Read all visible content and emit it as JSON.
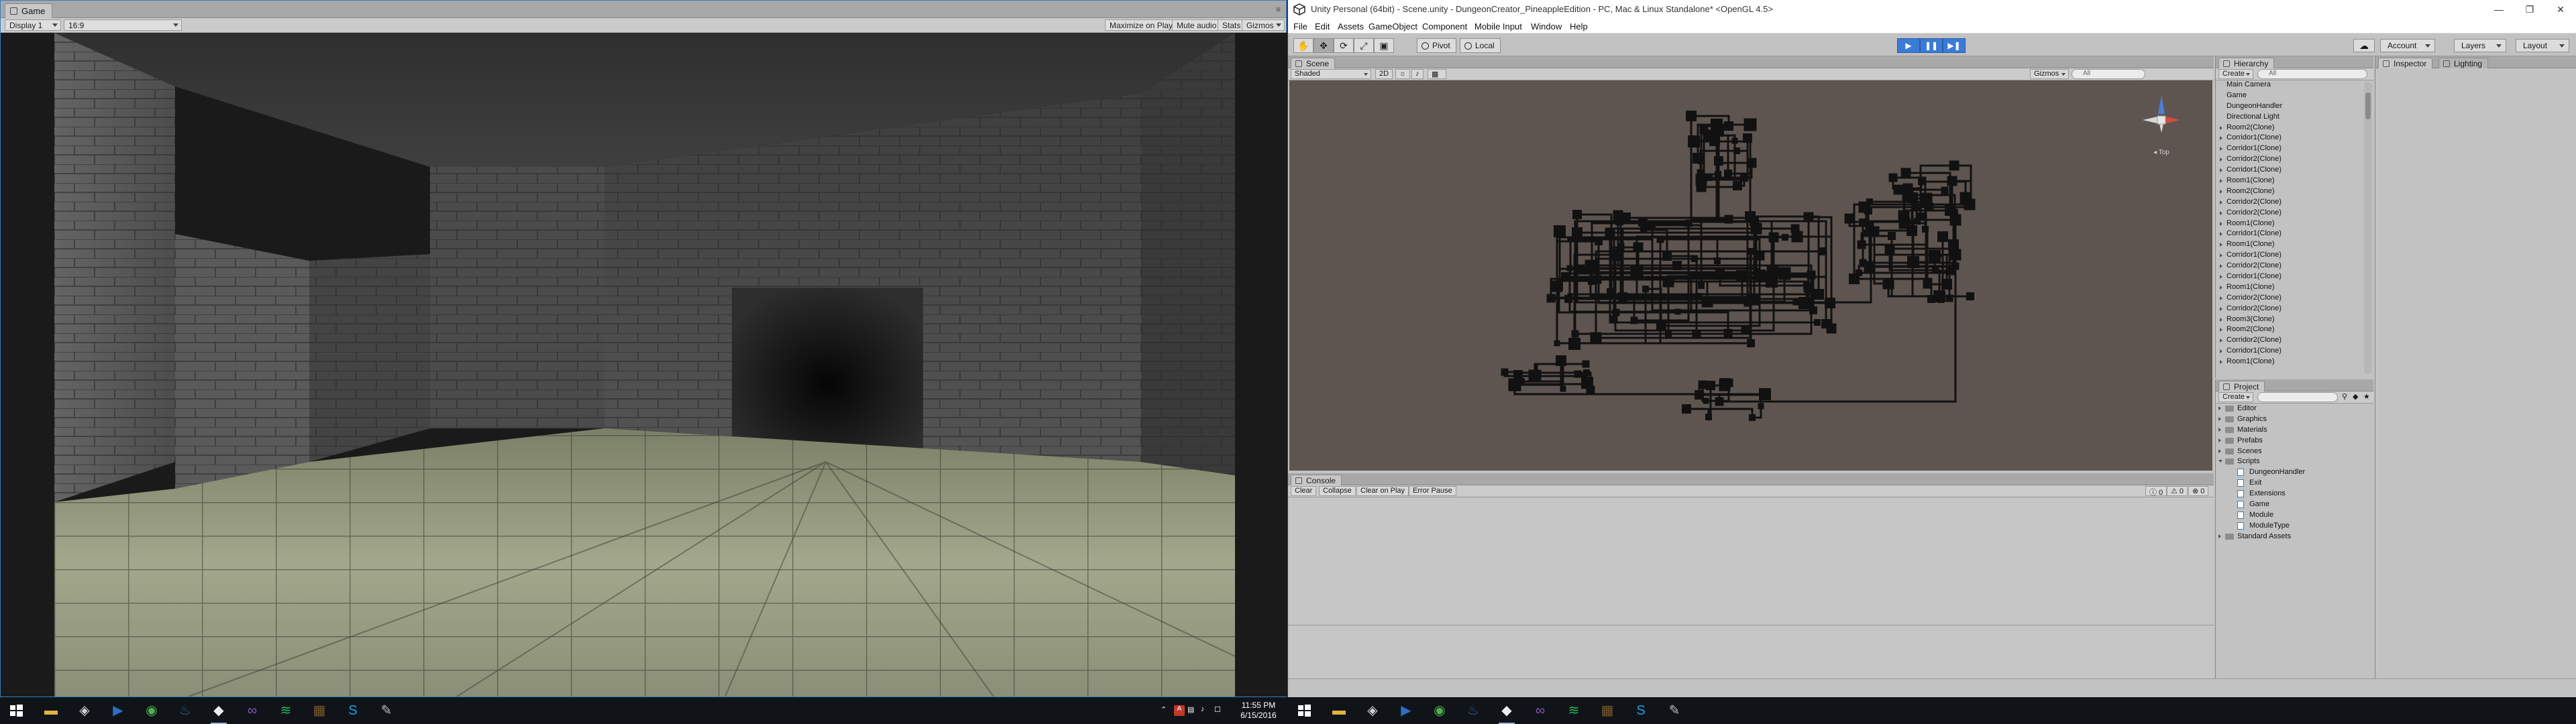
{
  "game": {
    "tab_title": "Game",
    "display_label": "Display 1",
    "aspect_label": "16:9",
    "maximize_label": "Maximize on Play",
    "mute_label": "Mute audio",
    "stats_label": "Stats",
    "gizmos_label": "Gizmos"
  },
  "editor": {
    "window_title": "Unity Personal (64bit) - Scene.unity - DungeonCreator_PineappleEdition - PC, Mac & Linux Standalone* <OpenGL 4.5>",
    "menu": [
      "File",
      "Edit",
      "Assets",
      "GameObject",
      "Component",
      "Mobile Input",
      "Window",
      "Help"
    ],
    "toolbar": {
      "pivot_label": "Pivot",
      "local_label": "Local",
      "account_label": "Account",
      "layers_label": "Layers",
      "layout_label": "Layout"
    },
    "scene": {
      "tab_title": "Scene",
      "shading": "Shaded",
      "mode_2d": "2D",
      "gizmos_label": "Gizmos",
      "search_placeholder": "All",
      "view_label": "Top"
    },
    "console": {
      "tab_title": "Console",
      "buttons": [
        "Clear",
        "Collapse",
        "Clear on Play",
        "Error Pause"
      ],
      "counts": [
        "0",
        "0",
        "0"
      ]
    },
    "hierarchy": {
      "tab_title": "Hierarchy",
      "create_label": "Create",
      "search_placeholder": "All",
      "items": [
        {
          "label": "Main Camera",
          "expandable": false
        },
        {
          "label": "Game",
          "expandable": false
        },
        {
          "label": "DungeonHandler",
          "expandable": false
        },
        {
          "label": "Directional Light",
          "expandable": false
        },
        {
          "label": "Room2(Clone)",
          "expandable": true
        },
        {
          "label": "Corridor1(Clone)",
          "expandable": true
        },
        {
          "label": "Corridor1(Clone)",
          "expandable": true
        },
        {
          "label": "Corridor2(Clone)",
          "expandable": true
        },
        {
          "label": "Corridor1(Clone)",
          "expandable": true
        },
        {
          "label": "Room1(Clone)",
          "expandable": true
        },
        {
          "label": "Room2(Clone)",
          "expandable": true
        },
        {
          "label": "Corridor2(Clone)",
          "expandable": true
        },
        {
          "label": "Corridor2(Clone)",
          "expandable": true
        },
        {
          "label": "Room1(Clone)",
          "expandable": true
        },
        {
          "label": "Corridor1(Clone)",
          "expandable": true
        },
        {
          "label": "Room1(Clone)",
          "expandable": true
        },
        {
          "label": "Corridor1(Clone)",
          "expandable": true
        },
        {
          "label": "Corridor2(Clone)",
          "expandable": true
        },
        {
          "label": "Corridor1(Clone)",
          "expandable": true
        },
        {
          "label": "Room1(Clone)",
          "expandable": true
        },
        {
          "label": "Corridor2(Clone)",
          "expandable": true
        },
        {
          "label": "Corridor2(Clone)",
          "expandable": true
        },
        {
          "label": "Room3(Clone)",
          "expandable": true
        },
        {
          "label": "Room2(Clone)",
          "expandable": true
        },
        {
          "label": "Corridor2(Clone)",
          "expandable": true
        },
        {
          "label": "Corridor1(Clone)",
          "expandable": true
        },
        {
          "label": "Room1(Clone)",
          "expandable": true
        }
      ]
    },
    "project": {
      "tab_title": "Project",
      "create_label": "Create",
      "items": [
        {
          "label": "Editor",
          "type": "folder",
          "indent": 0,
          "state": "collapsed"
        },
        {
          "label": "Graphics",
          "type": "folder",
          "indent": 0,
          "state": "collapsed"
        },
        {
          "label": "Materials",
          "type": "folder",
          "indent": 0,
          "state": "collapsed"
        },
        {
          "label": "Prefabs",
          "type": "folder",
          "indent": 0,
          "state": "collapsed"
        },
        {
          "label": "Scenes",
          "type": "folder",
          "indent": 0,
          "state": "collapsed"
        },
        {
          "label": "Scripts",
          "type": "folder",
          "indent": 0,
          "state": "expanded"
        },
        {
          "label": "DungeonHandler",
          "type": "script",
          "indent": 1,
          "state": "none"
        },
        {
          "label": "Exit",
          "type": "script",
          "indent": 1,
          "state": "none"
        },
        {
          "label": "Extensions",
          "type": "script",
          "indent": 1,
          "state": "none"
        },
        {
          "label": "Game",
          "type": "script",
          "indent": 1,
          "state": "none"
        },
        {
          "label": "Module",
          "type": "script",
          "indent": 1,
          "state": "none"
        },
        {
          "label": "ModuleType",
          "type": "script",
          "indent": 1,
          "state": "none"
        },
        {
          "label": "Standard Assets",
          "type": "folder",
          "indent": 0,
          "state": "collapsed"
        }
      ]
    },
    "inspector": {
      "tab_title": "Inspector",
      "lighting_tab": "Lighting"
    }
  },
  "taskbar": {
    "time": "11:55 PM",
    "date": "6/15/2016",
    "apps": [
      "file-explorer",
      "unity",
      "media-player",
      "chrome",
      "steam",
      "unity-running",
      "visual-studio",
      "spotify",
      "minecraft",
      "skype",
      "gimp"
    ]
  },
  "colors": {
    "editor_bg": "#c2c2c2",
    "scene_bg": "#5e5550",
    "play_blue": "#3b7bd6",
    "taskbar": "#101418"
  }
}
